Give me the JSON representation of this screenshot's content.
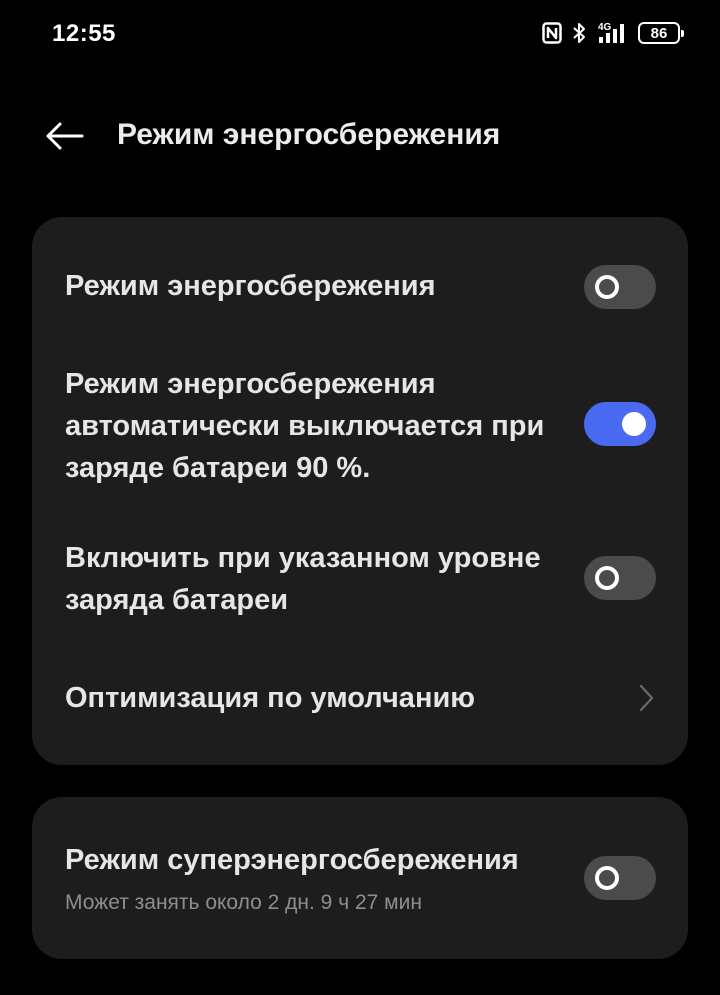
{
  "status_bar": {
    "time": "12:55",
    "icons": [
      "nfc-icon",
      "bluetooth-icon",
      "signal-4g-icon"
    ],
    "battery_level": "86"
  },
  "header": {
    "back_icon": "arrow-left-icon",
    "title": "Режим энергосбережения"
  },
  "settings": {
    "power_saving": {
      "label": "Режим энергосбережения",
      "enabled": false
    },
    "auto_off": {
      "label": "Режим энергосбережения автоматически выключается при заряде батареи 90 %.",
      "enabled": true
    },
    "enable_at_level": {
      "label": "Включить при указанном уровне заряда батареи",
      "enabled": false
    },
    "default_optimization": {
      "label": "Оптимизация по умолчанию",
      "icon": "chevron-right-icon"
    }
  },
  "super_saving": {
    "label": "Режим суперэнергосбережения",
    "subtitle": "Может занять около 2 дн. 9 ч 27 мин",
    "enabled": false
  },
  "colors": {
    "background": "#000000",
    "card": "#1d1d1d",
    "toggle_on": "#4a6af1",
    "toggle_off": "#4b4b4b",
    "subtitle": "#8e8e8e"
  }
}
